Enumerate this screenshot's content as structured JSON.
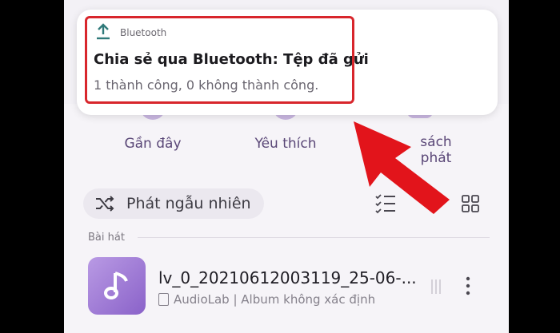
{
  "notification": {
    "app_name": "Bluetooth",
    "title": "Chia sẻ qua Bluetooth: Tệp đã gửi",
    "body": "1 thành công, 0 không thành công."
  },
  "categories": [
    {
      "label": "Gần đây"
    },
    {
      "label": "Yêu thích"
    },
    {
      "label": "sách phát"
    }
  ],
  "shuffle": {
    "label": "Phát ngẫu nhiên"
  },
  "section": {
    "label": "Bài hát"
  },
  "songs": [
    {
      "title": "lv_0_20210612003119_25-06-...",
      "subtitle": "AudioLab | Album không xác định"
    }
  ],
  "colors": {
    "highlight": "#d8262c",
    "accent": "#8a62c9",
    "arrow": "#e2141b"
  }
}
